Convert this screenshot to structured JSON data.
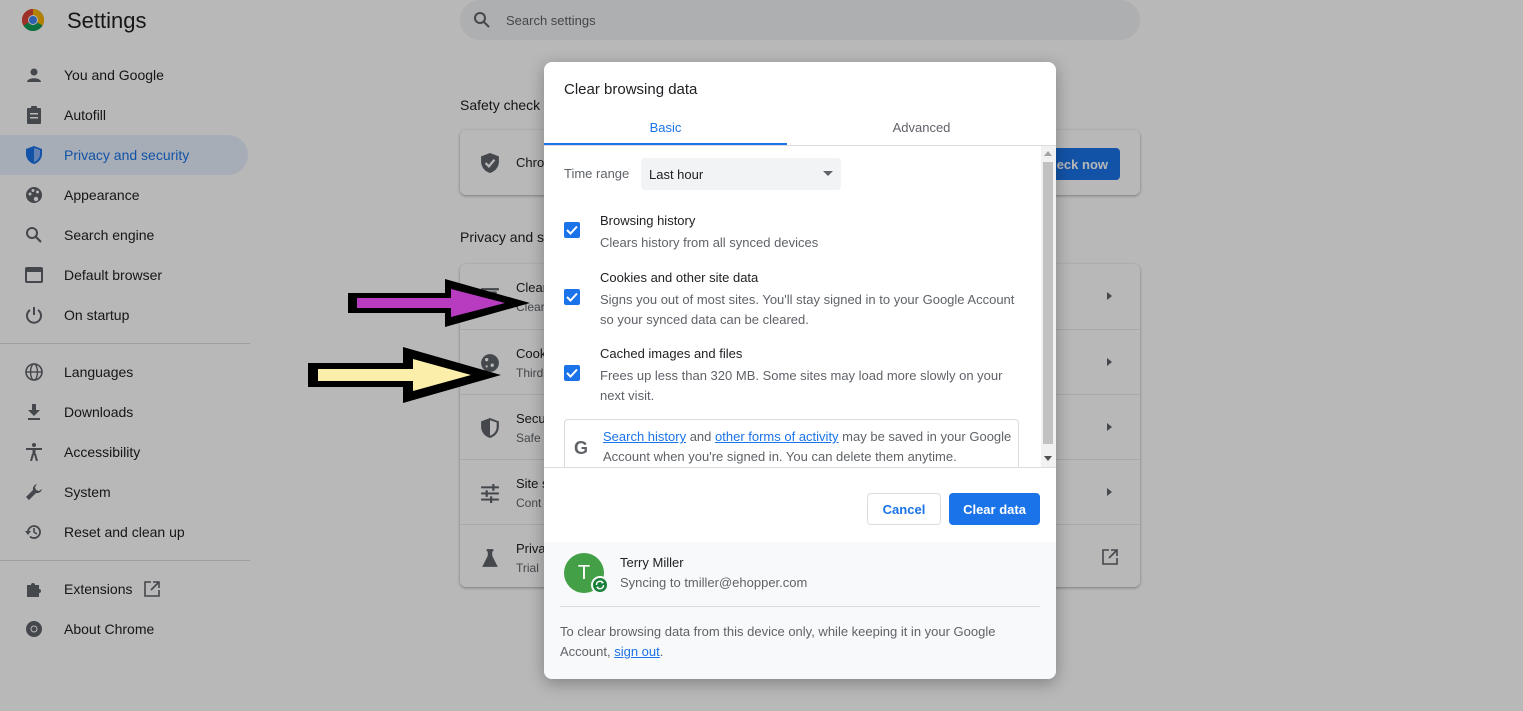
{
  "app": {
    "title": "Settings",
    "search_placeholder": "Search settings"
  },
  "sidebar": {
    "items": [
      {
        "label": "You and Google",
        "icon": "person-icon"
      },
      {
        "label": "Autofill",
        "icon": "clipboard-icon"
      },
      {
        "label": "Privacy and security",
        "icon": "shield-icon",
        "active": true
      },
      {
        "label": "Appearance",
        "icon": "palette-icon"
      },
      {
        "label": "Search engine",
        "icon": "search-icon"
      },
      {
        "label": "Default browser",
        "icon": "browser-window-icon"
      },
      {
        "label": "On startup",
        "icon": "power-icon"
      },
      {
        "label": "Languages",
        "icon": "globe-icon"
      },
      {
        "label": "Downloads",
        "icon": "download-icon"
      },
      {
        "label": "Accessibility",
        "icon": "accessibility-icon"
      },
      {
        "label": "System",
        "icon": "wrench-icon"
      },
      {
        "label": "Reset and clean up",
        "icon": "history-icon"
      },
      {
        "label": "Extensions",
        "icon": "puzzle-icon"
      },
      {
        "label": "About Chrome",
        "icon": "chrome-icon"
      }
    ]
  },
  "main": {
    "safety_check_title": "Safety check",
    "safety_row_title": "Chro",
    "check_now_label": "eck now",
    "privacy_title": "Privacy and s",
    "rows": [
      {
        "title": "Clear",
        "sub": "Clear",
        "icon": "trash-icon"
      },
      {
        "title": "Cook",
        "sub": "Third",
        "icon": "cookie-icon"
      },
      {
        "title": "Secu",
        "sub": "Safe",
        "icon": "shield-icon"
      },
      {
        "title": "Site s",
        "sub": "Cont",
        "icon": "sliders-icon"
      },
      {
        "title": "Priva",
        "sub": "Trial",
        "icon": "flask-icon"
      }
    ]
  },
  "dialog": {
    "title": "Clear browsing data",
    "tabs": [
      {
        "label": "Basic",
        "active": true
      },
      {
        "label": "Advanced",
        "active": false
      }
    ],
    "time_range_label": "Time range",
    "time_range_value": "Last hour",
    "options": [
      {
        "title": "Browsing history",
        "desc": "Clears history from all synced devices",
        "checked": true
      },
      {
        "title": "Cookies and other site data",
        "desc": "Signs you out of most sites. You'll stay signed in to your Google Account so your synced data can be cleared.",
        "checked": true
      },
      {
        "title": "Cached images and files",
        "desc": "Frees up less than 320 MB. Some sites may load more slowly on your next visit.",
        "checked": true
      }
    ],
    "google_note": {
      "link1": "Search history",
      "mid": " and ",
      "link2": "other forms of activity",
      "rest": " may be saved in your Google Account when you're signed in. You can delete them anytime."
    },
    "cancel_label": "Cancel",
    "clear_label": "Clear data",
    "account": {
      "initial": "T",
      "name": "Terry Miller",
      "sync_text": "Syncing to tmiller@ehopper.com",
      "note_prefix": "To clear browsing data from this device only, while keeping it in your Google Account, ",
      "note_link": "sign out",
      "note_suffix": "."
    }
  },
  "colors": {
    "accent": "#1a73e8",
    "arrow_purple": "#b83cc0",
    "arrow_yellow": "#fbeeab",
    "avatar": "#43a047"
  }
}
